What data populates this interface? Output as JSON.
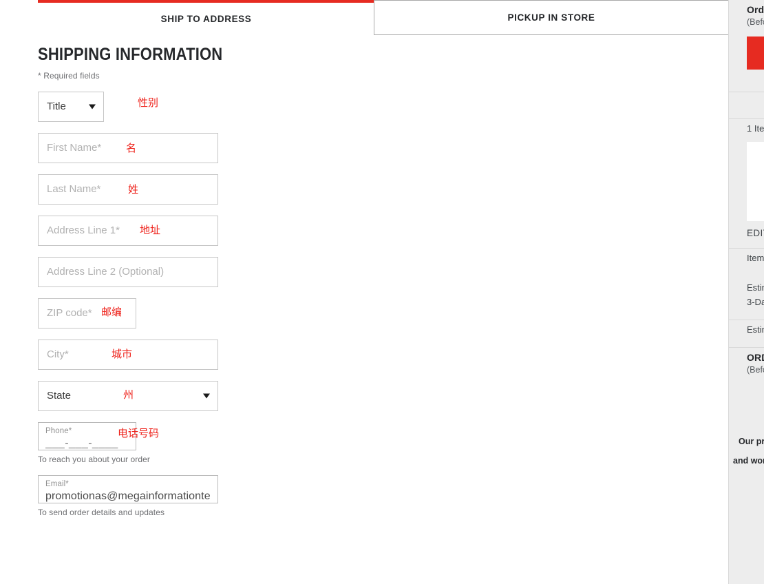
{
  "tabs": [
    {
      "label": "SHIP TO ADDRESS",
      "active": true
    },
    {
      "label": "PICKUP IN STORE",
      "active": false
    }
  ],
  "form": {
    "heading": "SHIPPING INFORMATION",
    "required_note": "* Required fields",
    "fields": {
      "title": {
        "selected": "Title",
        "annotation": "性别"
      },
      "first_name": {
        "placeholder": "First Name*",
        "annotation": "名"
      },
      "last_name": {
        "placeholder": "Last Name*",
        "annotation": "姓"
      },
      "address1": {
        "placeholder": "Address Line 1*",
        "annotation": "地址"
      },
      "address2": {
        "placeholder": "Address Line 2 (Optional)",
        "annotation": ""
      },
      "zip": {
        "placeholder": "ZIP code*",
        "annotation": "邮编"
      },
      "city": {
        "placeholder": "City*",
        "annotation": "城市"
      },
      "state": {
        "selected": "State",
        "annotation": "州"
      },
      "phone": {
        "label": "Phone*",
        "value": "___-___-____",
        "helper": "To reach you about your order",
        "annotation": "电话号码"
      },
      "email": {
        "label": "Email*",
        "value": "promotionas@megainformationte",
        "helper": "To send order details and updates",
        "annotation": ""
      }
    }
  },
  "sidebar": {
    "order_title": "Order",
    "order_sub": "(Befo",
    "checkout_button_label": "",
    "item_count": "1 Ite",
    "edit_label": "EDIT",
    "items_line": "Item",
    "estimated_line1": "Estim",
    "estimated_line2": "3-Da",
    "estimated_line3": "Estim",
    "order_total_title": "ORD",
    "order_total_sub": "(Befo",
    "footer_line1": "Our prod",
    "footer_line2": "and work"
  },
  "colors": {
    "accent_red": "#e62b21",
    "annotation_red": "#ee2019",
    "border_gray": "#c6c6c6",
    "sidebar_bg": "#ededed"
  }
}
